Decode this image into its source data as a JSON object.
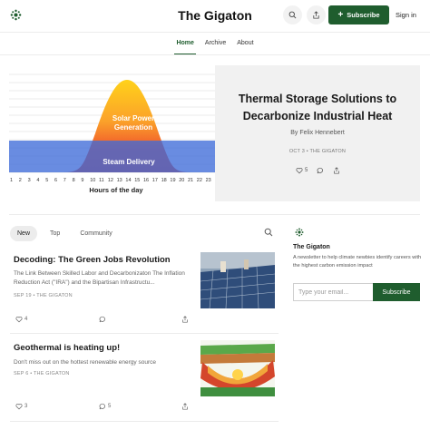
{
  "header": {
    "site_title": "The Gigaton",
    "subscribe_label": "Subscribe",
    "signin_label": "Sign in",
    "brand_color": "#1f5d2e"
  },
  "nav": {
    "items": [
      "Home",
      "Archive",
      "About"
    ],
    "active": "Home"
  },
  "featured": {
    "image": {
      "ticks": [
        "1",
        "2",
        "3",
        "4",
        "5",
        "6",
        "7",
        "8",
        "9",
        "10",
        "11",
        "12",
        "13",
        "14",
        "15",
        "16",
        "17",
        "18",
        "19",
        "20",
        "21",
        "22",
        "23"
      ],
      "xlabel": "Hours of the day",
      "solar_label_line1": "Solar Power",
      "solar_label_line2": "Generation",
      "steam_label": "Steam Delivery"
    },
    "title": "Thermal Storage Solutions to Decarbonize Industrial Heat",
    "author": "By Felix Hennebert",
    "meta": "OCT 3 • THE GIGATON",
    "likes": "5"
  },
  "tabs": {
    "items": [
      "New",
      "Top",
      "Community"
    ],
    "active": "New"
  },
  "posts": [
    {
      "title": "Decoding: The Green Jobs Revolution",
      "desc": "The Link Between Skilled Labor and Decarbonizaton The Inflation Reduction Act (\"IRA\") and the Bipartisan Infrastructu...",
      "meta": "SEP 19 • THE GIGATON",
      "likes": "4",
      "comments": ""
    },
    {
      "title": "Geothermal is heating up!",
      "desc": "Don't miss out on the hottest renewable energy source",
      "meta": "SEP 6 • THE GIGATON",
      "likes": "3",
      "comments": "5"
    }
  ],
  "sidebar": {
    "name": "The Gigaton",
    "desc": "A newsletter to help climate newbies identify careers with the highest carbon emission impact",
    "email_placeholder": "Type your email...",
    "subscribe_label": "Subscribe"
  }
}
